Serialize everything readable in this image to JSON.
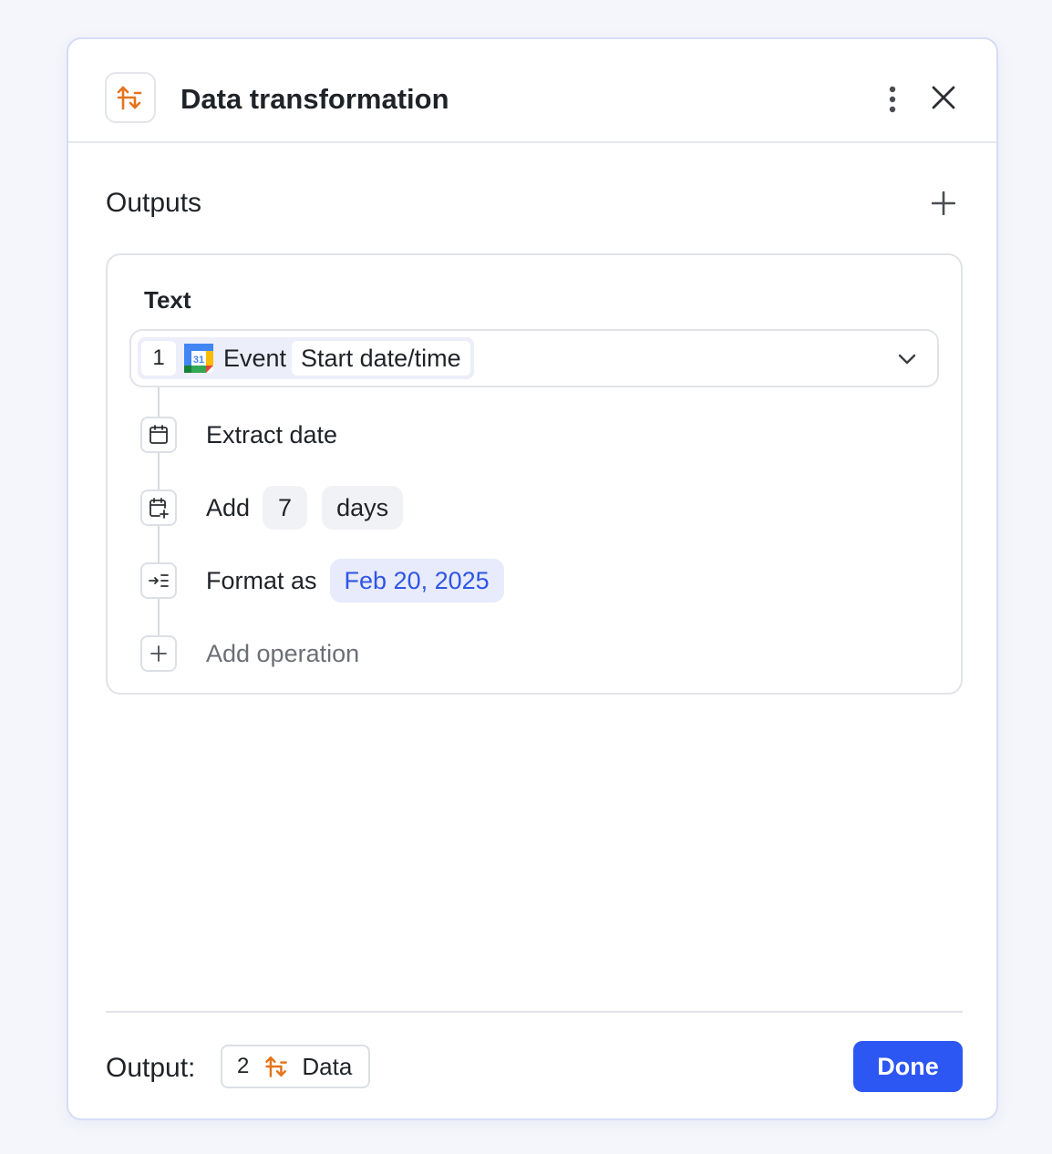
{
  "header": {
    "title": "Data transformation",
    "icon": "transform-arrows-icon",
    "accent_color": "#e5741c"
  },
  "outputs": {
    "section_title": "Outputs",
    "item": {
      "label": "Text",
      "source": {
        "step_number": "1",
        "app_icon": "google-calendar-icon",
        "object": "Event",
        "field": "Start date/time"
      },
      "operations": [
        {
          "icon": "calendar-icon",
          "label": "Extract date"
        },
        {
          "icon": "calendar-add-icon",
          "label": "Add",
          "value": "7",
          "unit": "days"
        },
        {
          "icon": "format-icon",
          "label": "Format as",
          "value": "Feb 20, 2025"
        }
      ],
      "add_operation_label": "Add operation"
    }
  },
  "footer": {
    "output_label": "Output:",
    "output_step_number": "2",
    "output_name": "Data",
    "done_label": "Done",
    "done_color": "#2d57f2"
  }
}
